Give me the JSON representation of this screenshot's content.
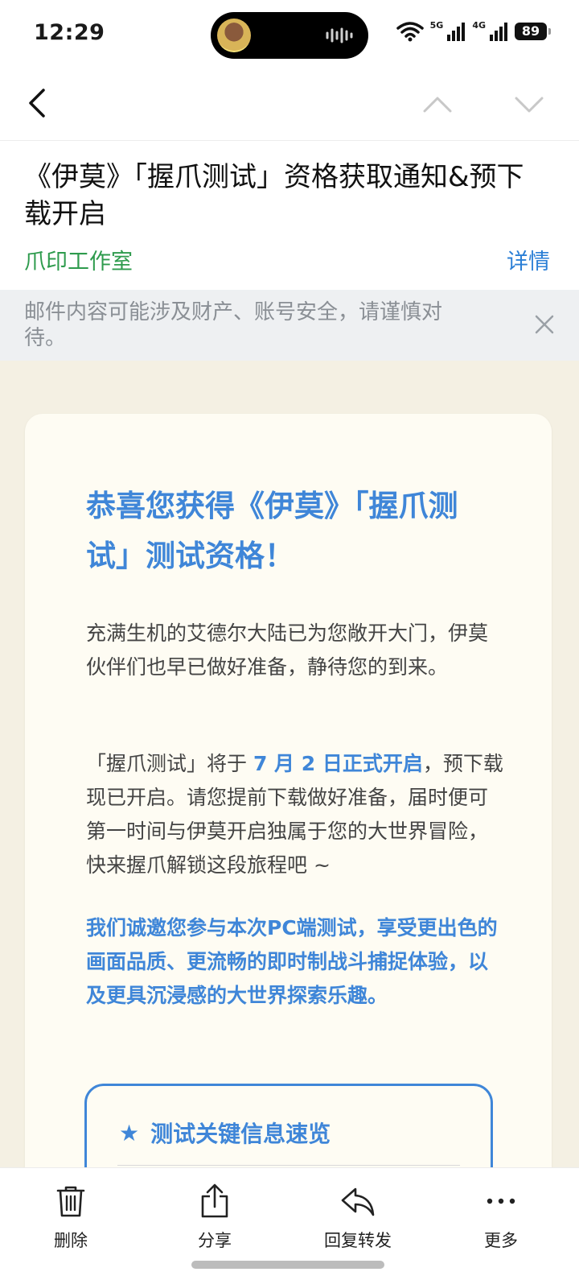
{
  "status_bar": {
    "time": "12:29",
    "signal1_label": "5G",
    "signal2_label": "4G",
    "battery": "89"
  },
  "nav": {
    "back_icon": "chevron-left-icon",
    "prev_icon": "chevron-up-icon",
    "next_icon": "chevron-down-icon"
  },
  "header": {
    "subject": "《伊莫》「握爪测试」资格获取通知&预下载开启",
    "sender": "爪印工作室",
    "details_label": "详情",
    "sender_color": "#2e9b4d",
    "link_color": "#2b7fd6"
  },
  "warning": {
    "text": "邮件内容可能涉及财产、账号安全，请谨慎对待。"
  },
  "email": {
    "accent_color": "#3f86d8",
    "title": "恭喜您获得《伊莫》「握爪测试」测试资格！",
    "para1": "充满生机的艾德尔大陆已为您敞开大门，伊莫伙伴们也早已做好准备，静待您的到来。",
    "para2_before": "「握爪测试」将于 ",
    "para2_highlight": "7 月 2 日正式开启",
    "para2_after": "，预下载现已开启。请您提前下载做好准备，届时便可第一时间与伊莫开启独属于您的大世界冒险，快来握爪解锁这段旅程吧 ~",
    "para3": "我们诚邀您参与本次PC端测试，享受更出色的画面品质、更流畅的即时制战斗捕捉体验，以及更具沉浸感的大世界探索乐趣。",
    "info_box": {
      "star": "★",
      "title": "测试关键信息速览"
    }
  },
  "toolbar": {
    "items": [
      {
        "label": "删除",
        "icon": "trash-icon"
      },
      {
        "label": "分享",
        "icon": "share-icon"
      },
      {
        "label": "回复转发",
        "icon": "reply-icon"
      },
      {
        "label": "更多",
        "icon": "more-icon"
      }
    ]
  }
}
